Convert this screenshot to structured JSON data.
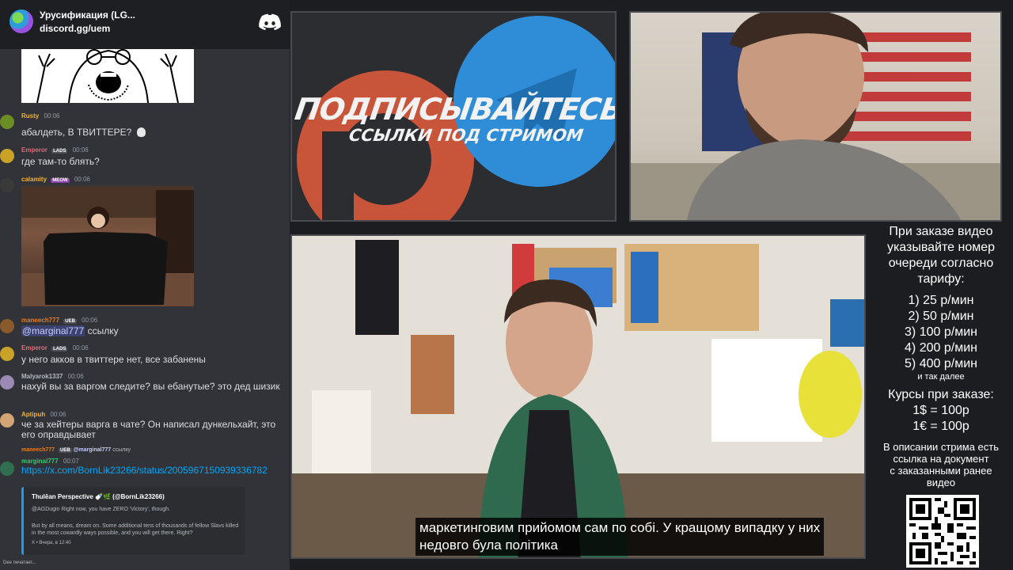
{
  "server": {
    "name": "Урусификация (LG...",
    "invite": "discord.gg/uem"
  },
  "messages": [
    {
      "author": "Rusty",
      "time": "00:06",
      "text": "абалдеть, В ТВИТТЕРЕ?",
      "color": "#f0b232"
    },
    {
      "author": "Emperor",
      "tag": "LADS",
      "time": "00:06",
      "text": "где там-то блять?",
      "color": "#e06c75"
    },
    {
      "author": "calamity",
      "tag": "MEOW",
      "time": "00:06",
      "color": "#f0b232"
    },
    {
      "author": "maneech777",
      "tag": "UEB",
      "time": "00:06",
      "mention": "@marginal777",
      "text": "ссылку",
      "color": "#e67e22"
    },
    {
      "author": "Emperor",
      "tag": "LADS",
      "time": "00:06",
      "text": "у него акков в твиттере нет, все забанены",
      "color": "#e06c75"
    },
    {
      "author": "Malyarok1337",
      "time": "00:06",
      "text": "нахуй вы за варгом следите? вы ебанутые? это дед шизик",
      "color": "#b5bac1"
    },
    {
      "author": "Aptipuh",
      "time": "00:06",
      "text": "че за хейтеры варга в чате? Он написал дункельхайт, это его оправдывает",
      "color": "#f0b232"
    },
    {
      "author": "marginal777",
      "time": "00:07",
      "reply_author": "maneech777",
      "reply_tag": "UEB",
      "reply_mention": "@marginal777",
      "reply_text": "ссылку",
      "link": "https://x.com/BornLik23266/status/2005967150939336782",
      "color": "#2ecc71"
    }
  ],
  "embed": {
    "author": "Thulēan Perspective 🍼🌿 (@BornLik23266)",
    "line1": "@AGDugin Right now, you have ZERO 'Victory', though.",
    "line2": "But by all means, dream on. Some additional tens of thousands of fellow Slavs killed in the most cowardly ways possible, and you will get there. Right?",
    "footer": "X • Вчера, в 12:40"
  },
  "typing": "Dee печатает...",
  "banner": {
    "title": "ПОДПИСЫВАЙТЕСЬ",
    "subtitle": "ССЫЛКИ ПОД СТРИМОМ"
  },
  "subtitles": {
    "line1": "маркетинговим прийомом сам по собі. У кращому випадку у них",
    "line2": "недовго була політика"
  },
  "info": {
    "heading": [
      "При заказе видео",
      "указывайте номер",
      "очереди согласно",
      "тарифу:"
    ],
    "tariffs": [
      "1) 25 р/мин",
      "2) 50 р/мин",
      "3) 100 р/мин",
      "4) 200 р/мин",
      "5) 400 р/мин"
    ],
    "etc": "и так далее",
    "rates_title": "Курсы при заказе:",
    "rates": [
      "1$ = 100р",
      "1€ = 100р"
    ],
    "note": [
      "В описании стрима есть",
      "ссылка на документ",
      "с заказанными ранее",
      "видео"
    ]
  },
  "colors": {
    "discord_bg": "#313338",
    "telegram_blue": "#2f8dd8",
    "patreon_orange": "#c8543a"
  }
}
